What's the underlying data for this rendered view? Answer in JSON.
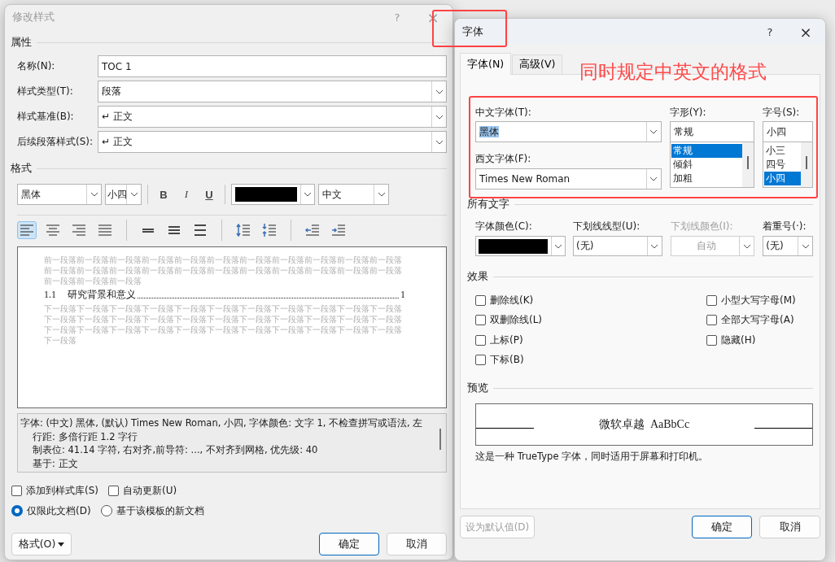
{
  "modify_dialog": {
    "title": "修改样式",
    "help": "?",
    "close": "×",
    "properties": {
      "heading": "属性",
      "fields": [
        {
          "label": "名称(N):",
          "value": "TOC 1",
          "kind": "text"
        },
        {
          "label": "样式类型(T):",
          "value": "段落",
          "kind": "dropdown"
        },
        {
          "label": "样式基准(B):",
          "value": "↵ 正文",
          "kind": "dropdown"
        },
        {
          "label": "后续段落样式(S):",
          "value": "↵ 正文",
          "kind": "dropdown"
        }
      ]
    },
    "format": {
      "heading": "格式",
      "font": "黑体",
      "size": "小四",
      "styles": [
        {
          "label": "B",
          "kind": "bold",
          "selected": false
        },
        {
          "label": "I",
          "kind": "italic",
          "selected": false
        },
        {
          "label": "U",
          "kind": "underline",
          "selected": false
        }
      ],
      "script": "中文"
    },
    "paragraph_tools": [
      {
        "kind": "align-left",
        "selected": true
      },
      {
        "kind": "align-center",
        "selected": false
      },
      {
        "kind": "align-right",
        "selected": false
      },
      {
        "kind": "justify",
        "selected": false
      },
      {
        "kind": "spacing-single",
        "selected": false
      },
      {
        "kind": "spacing-onehalf",
        "selected": false
      },
      {
        "kind": "spacing-double",
        "selected": false
      },
      {
        "kind": "para-space-add",
        "selected": false
      },
      {
        "kind": "para-space-remove",
        "selected": false
      },
      {
        "kind": "indent-decrease",
        "selected": false
      },
      {
        "kind": "indent-increase",
        "selected": false
      }
    ],
    "preview": {
      "previous_text": "前一段落前一段落前一段落前一段落前一段落前一段落前一段落前一段落前一段落前一段落前一段落前一段落前一段落前一段落前一段落前一段落前一段落前一段落前一段落前一段落前一段落前一段落前一段落前一段落前一段落",
      "entry_number": "1.1",
      "entry_title": "研究背景和意义",
      "page": "1",
      "next_text": "下一段落下一段落下一段落下一段落下一段落下一段落下一段落下一段落下一段落下一段落下一段落下一段落下一段落下一段落下一段落下一段落下一段落下一段落下一段落下一段落下一段落下一段落下一段落下一段落下一段落下一段落下一段落下一段落下一段落下一段落下一段落下一段落下一段落下一段落"
    },
    "description": [
      "字体: (中文) 黑体, (默认) Times New Roman, 小四, 字体颜色: 文字 1, 不检查拼写或语法, 左",
      "行距: 多倍行距 1.2 字行",
      "制表位:  41.14 字符, 右对齐,前导符: ..., 不对齐到网格, 优先级: 40",
      "基于: 正文"
    ],
    "options": [
      {
        "label": "添加到样式库(S)",
        "checked": false
      },
      {
        "label": "自动更新(U)",
        "checked": false
      }
    ],
    "scope": [
      {
        "label": "仅限此文档(D)",
        "selected": true
      },
      {
        "label": "基于该模板的新文档",
        "selected": false
      }
    ],
    "format_button": "格式(O)",
    "ok": "确定",
    "cancel": "取消"
  },
  "font_dialog": {
    "title": "字体",
    "help": "?",
    "close": "×",
    "tabs": [
      {
        "label": "字体(N)",
        "selected": true
      },
      {
        "label": "高级(V)",
        "selected": false
      }
    ],
    "chinese_font": {
      "label": "中文字体(T):",
      "value": "黑体",
      "highlighted": true
    },
    "western_font": {
      "label": "西文字体(F):",
      "value": "Times New Roman",
      "highlighted": false
    },
    "style": {
      "label": "字形(Y):",
      "value": "常规",
      "options": [
        {
          "label": "常规",
          "selected": true
        },
        {
          "label": "倾斜",
          "selected": false
        },
        {
          "label": "加粗",
          "selected": false
        }
      ]
    },
    "size": {
      "label": "字号(S):",
      "value": "小四",
      "options": [
        {
          "label": "小三",
          "selected": false
        },
        {
          "label": "四号",
          "selected": false
        },
        {
          "label": "小四",
          "selected": true
        }
      ]
    },
    "all_text": {
      "heading": "所有文字",
      "fields": [
        {
          "label": "字体颜色(C):",
          "kind": "color",
          "disabled": false
        },
        {
          "label": "下划线线型(U):",
          "kind": "dropdown",
          "value": "(无)",
          "disabled": false
        },
        {
          "label": "下划线颜色(I):",
          "kind": "dropdown",
          "value": "自动",
          "disabled": true
        },
        {
          "label": "着重号(·):",
          "kind": "dropdown",
          "value": "(无)",
          "disabled": false
        }
      ]
    },
    "effects": {
      "heading": "效果",
      "left": [
        {
          "label": "删除线(K)",
          "checked": false
        },
        {
          "label": "双删除线(L)",
          "checked": false
        },
        {
          "label": "上标(P)",
          "checked": false
        },
        {
          "label": "下标(B)",
          "checked": false
        }
      ],
      "right": [
        {
          "label": "小型大写字母(M)",
          "checked": false
        },
        {
          "label": "全部大写字母(A)",
          "checked": false
        },
        {
          "label": "隐藏(H)",
          "checked": false
        }
      ]
    },
    "preview": {
      "heading": "预览",
      "sample": "微软卓越  AaBbCc",
      "note": "这是一种 TrueType 字体，同时适用于屏幕和打印机。"
    },
    "set_default": {
      "label": "设为默认值(D)",
      "disabled": true
    },
    "ok": "确定",
    "cancel": "取消"
  },
  "annotation": {
    "text": "同时规定中英文的格式"
  }
}
